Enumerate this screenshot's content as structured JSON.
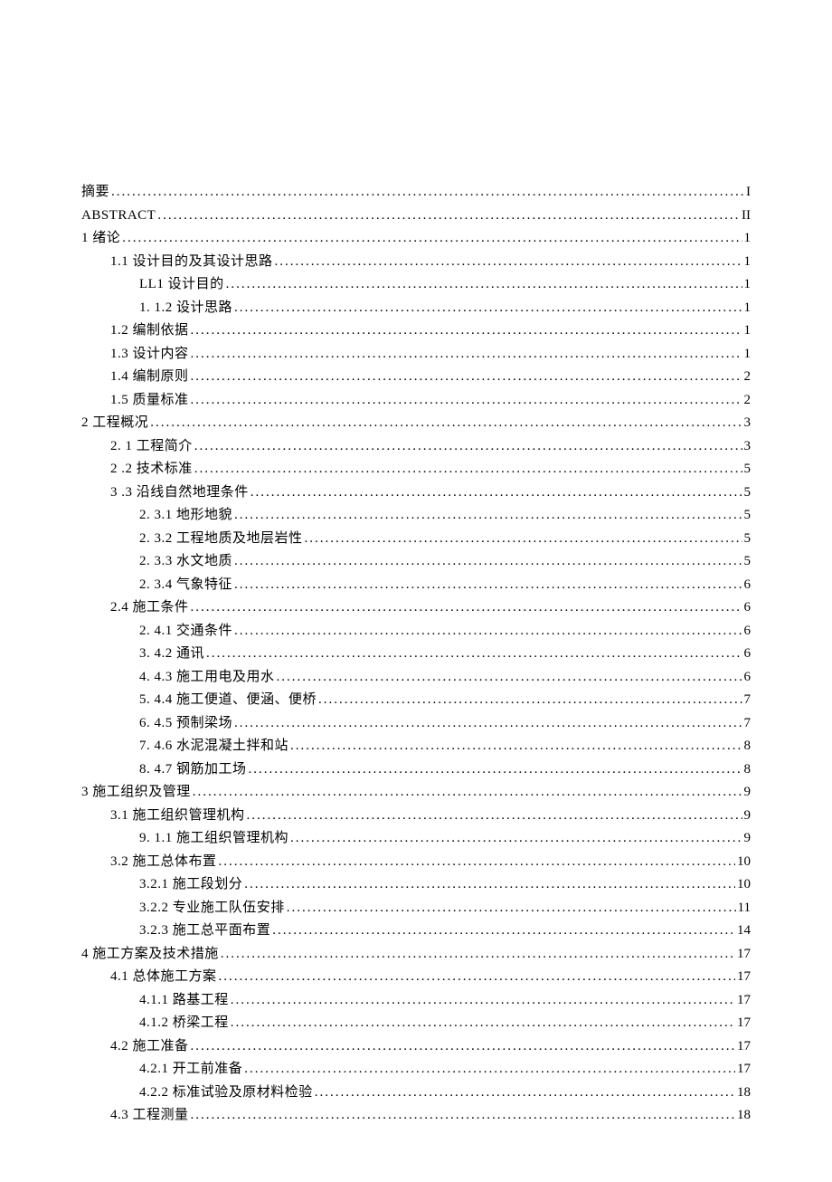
{
  "toc": [
    {
      "label": "摘要",
      "page": "I",
      "indent": 0
    },
    {
      "label": "ABSTRACT",
      "page": "II",
      "indent": 0
    },
    {
      "label": "1 绪论",
      "page": "1",
      "indent": 0
    },
    {
      "label": "1.1 设计目的及其设计思路",
      "page": "1",
      "indent": 1
    },
    {
      "label": "LL1 设计目的",
      "page": "1",
      "indent": 2
    },
    {
      "label": "1.  1.2 设计思路",
      "page": "1",
      "indent": 2
    },
    {
      "label": "1.2 编制依据",
      "page": "1",
      "indent": 1
    },
    {
      "label": "1.3 设计内容",
      "page": "1",
      "indent": 1
    },
    {
      "label": "1.4 编制原则",
      "page": "2",
      "indent": 1
    },
    {
      "label": "1.5 质量标准",
      "page": "2",
      "indent": 1
    },
    {
      "label": "2 工程概况",
      "page": "3",
      "indent": 0
    },
    {
      "label": "2.  1 工程简介",
      "page": "3",
      "indent": 1
    },
    {
      "label": "2  .2 技术标准",
      "page": "5",
      "indent": 1
    },
    {
      "label": "3  .3 沿线自然地理条件",
      "page": "5",
      "indent": 1
    },
    {
      "label": "2.  3.1 地形地貌",
      "page": "5",
      "indent": 2
    },
    {
      "label": "2.  3.2 工程地质及地层岩性",
      "page": "5",
      "indent": 2
    },
    {
      "label": "2.  3.3 水文地质",
      "page": "5",
      "indent": 2
    },
    {
      "label": "2.  3.4 气象特征",
      "page": "6",
      "indent": 2
    },
    {
      "label": "2.4 施工条件",
      "page": "6",
      "indent": 1
    },
    {
      "label": "2.  4.1 交通条件",
      "page": "6",
      "indent": 2
    },
    {
      "label": "3.  4.2 通讯",
      "page": "6",
      "indent": 2
    },
    {
      "label": "4.  4.3 施工用电及用水",
      "page": "6",
      "indent": 2
    },
    {
      "label": "5.  4.4 施工便道、便涵、便桥",
      "page": "7",
      "indent": 2
    },
    {
      "label": "6.  4.5 预制梁场",
      "page": "7",
      "indent": 2
    },
    {
      "label": "7.  4.6 水泥混凝土拌和站",
      "page": "8",
      "indent": 2
    },
    {
      "label": "8.  4.7 钢筋加工场",
      "page": "8",
      "indent": 2
    },
    {
      "label": "3 施工组织及管理",
      "page": "9",
      "indent": 0
    },
    {
      "label": "3.1 施工组织管理机构",
      "page": "9",
      "indent": 1
    },
    {
      "label": "9.  1.1 施工组织管理机构",
      "page": "9",
      "indent": 2
    },
    {
      "label": "3.2 施工总体布置",
      "page": "10",
      "indent": 1
    },
    {
      "label": "3.2.1 施工段划分",
      "page": "10",
      "indent": 2
    },
    {
      "label": "3.2.2 专业施工队伍安排",
      "page": "11",
      "indent": 2
    },
    {
      "label": "3.2.3 施工总平面布置",
      "page": "14",
      "indent": 2
    },
    {
      "label": "4 施工方案及技术措施",
      "page": "17",
      "indent": 0
    },
    {
      "label": "4.1 总体施工方案",
      "page": "17",
      "indent": 1
    },
    {
      "label": "4.1.1 路基工程",
      "page": "17",
      "indent": 2
    },
    {
      "label": "4.1.2 桥梁工程",
      "page": "17",
      "indent": 2
    },
    {
      "label": "4.2 施工准备",
      "page": "17",
      "indent": 1
    },
    {
      "label": "4.2.1 开工前准备",
      "page": "17",
      "indent": 2
    },
    {
      "label": "4.2.2 标准试验及原材料检验",
      "page": "18",
      "indent": 2
    },
    {
      "label": "4.3 工程测量",
      "page": "18",
      "indent": 1
    }
  ]
}
